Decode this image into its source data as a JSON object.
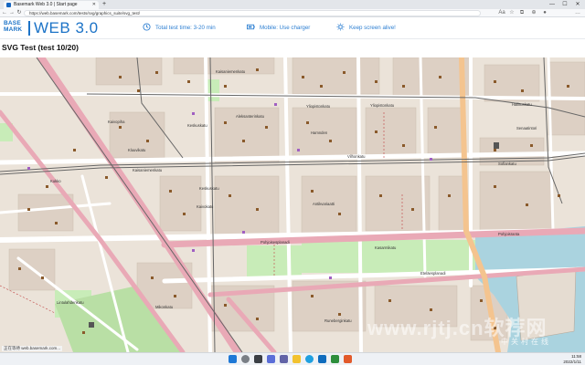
{
  "browser": {
    "tab_title": "Basemark Web 3.0 | Start page",
    "tab_close": "✕",
    "new_tab": "+",
    "url": "https://web.basemark.com/tests/svg/graphics_suite/svg_test/",
    "window_controls": [
      "—",
      "☐",
      "✕"
    ],
    "nav": [
      "←",
      "→",
      "↻"
    ]
  },
  "header": {
    "logo_top": "BASE",
    "logo_bottom": "MARK",
    "logo_product": "WEB 3.0",
    "test_time": "Total test time: 3-20 min",
    "charger": "Mobile: Use charger",
    "screen": "Keep screen alive!",
    "accent": "#1c73c7"
  },
  "page": {
    "title": "SVG Test (test 10/20)"
  },
  "map": {
    "street_labels": [
      "Kaisaniemenkatu",
      "Yliopistonkatu",
      "Yliopistonkatu",
      "Hallituskatu",
      "Kaivopiha",
      "Keskuskatu",
      "Aleksanterinkatu",
      "Hamnden",
      "Senaatintori",
      "Kluuvikatu",
      "Vilhonkatu",
      "Kaisaniemenkatu",
      "Sofiankatu",
      "Kukko",
      "Kaivokatu",
      "Pohjoisesplanadi",
      "Eteläesplanadi",
      "Keskuskatu",
      "Antikvariaatti",
      "Pohjoisranta",
      "Lintulahdenkatu",
      "Kasarmikatu",
      "Mikonkatu",
      "Runeberginkatu"
    ]
  },
  "watermark": {
    "main": "www.rjtj.cn软荐网",
    "sub": "中关村在线"
  },
  "status_text": "正在等待 web.basemark.com...",
  "taskbar": {
    "time": "11:58",
    "date": "2022/1/11"
  }
}
